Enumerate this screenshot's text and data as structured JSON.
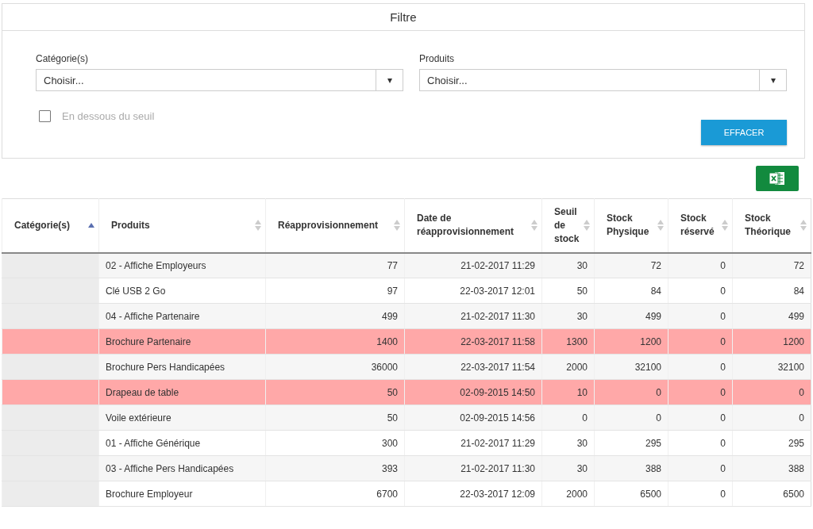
{
  "filter": {
    "title": "Filtre",
    "fields": [
      {
        "label": "Catégorie(s)",
        "placeholder": "Choisir...",
        "caret": "▾"
      },
      {
        "label": "Produits",
        "placeholder": "Choisir...",
        "caret": "▾"
      }
    ],
    "checkbox": {
      "label": "En dessous du seuil",
      "checked": false
    },
    "clear_button": "EFFACER"
  },
  "table": {
    "columns": [
      {
        "label": "Catégorie(s)",
        "sorted": true
      },
      {
        "label": "Produits",
        "sorted": false
      },
      {
        "label": "Réapprovisionnement",
        "sorted": false
      },
      {
        "label": "Date de réapprovisionnement",
        "sorted": false
      },
      {
        "label": "Seuil de stock",
        "sorted": false
      },
      {
        "label": "Stock Physique",
        "sorted": false
      },
      {
        "label": "Stock réservé",
        "sorted": false
      },
      {
        "label": "Stock Théorique",
        "sorted": false
      }
    ],
    "rows": [
      {
        "alert": false,
        "cells": [
          "",
          "02 - Affiche Employeurs",
          "77",
          "21-02-2017 11:29",
          "30",
          "72",
          "0",
          "72"
        ]
      },
      {
        "alert": false,
        "cells": [
          "",
          "Clé USB 2 Go",
          "97",
          "22-03-2017 12:01",
          "50",
          "84",
          "0",
          "84"
        ]
      },
      {
        "alert": false,
        "cells": [
          "",
          "04 - Affiche Partenaire",
          "499",
          "21-02-2017 11:30",
          "30",
          "499",
          "0",
          "499"
        ]
      },
      {
        "alert": true,
        "cells": [
          "",
          "Brochure Partenaire",
          "1400",
          "22-03-2017 11:58",
          "1300",
          "1200",
          "0",
          "1200"
        ]
      },
      {
        "alert": false,
        "cells": [
          "",
          "Brochure Pers Handicapées",
          "36000",
          "22-03-2017 11:54",
          "2000",
          "32100",
          "0",
          "32100"
        ]
      },
      {
        "alert": true,
        "cells": [
          "",
          "Drapeau de table",
          "50",
          "02-09-2015 14:50",
          "10",
          "0",
          "0",
          "0"
        ]
      },
      {
        "alert": false,
        "cells": [
          "",
          "Voile extérieure",
          "50",
          "02-09-2015 14:56",
          "0",
          "0",
          "0",
          "0"
        ]
      },
      {
        "alert": false,
        "cells": [
          "",
          "01 - Affiche Générique",
          "300",
          "21-02-2017 11:29",
          "30",
          "295",
          "0",
          "295"
        ]
      },
      {
        "alert": false,
        "cells": [
          "",
          "03 - Affiche Pers Handicapées",
          "393",
          "21-02-2017 11:30",
          "30",
          "388",
          "0",
          "388"
        ]
      },
      {
        "alert": false,
        "cells": [
          "",
          "Brochure Employeur",
          "6700",
          "22-03-2017 12:09",
          "2000",
          "6500",
          "0",
          "6500"
        ]
      }
    ]
  }
}
